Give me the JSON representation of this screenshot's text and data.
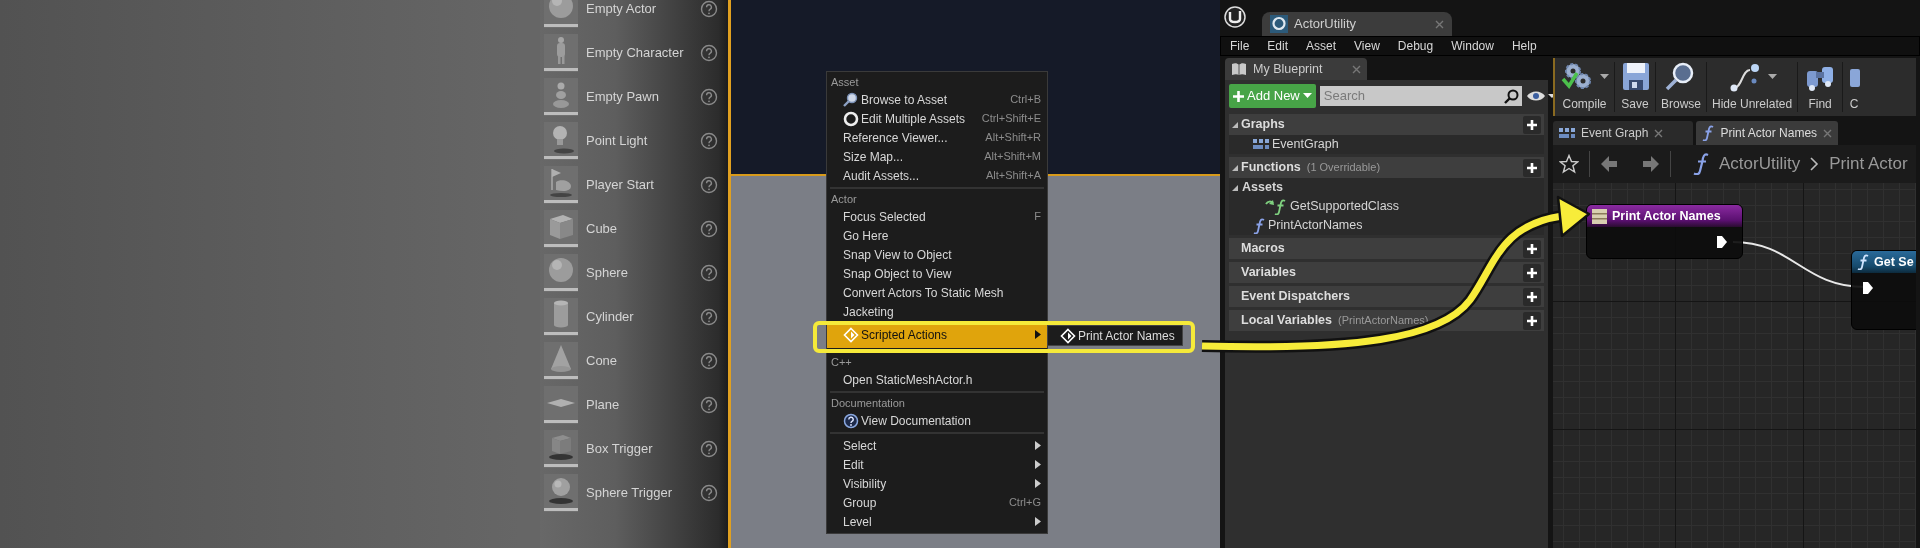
{
  "place_actors": {
    "items": [
      {
        "label": "Empty Actor",
        "kind": "sphere"
      },
      {
        "label": "Empty Character",
        "kind": "character"
      },
      {
        "label": "Empty Pawn",
        "kind": "pawn"
      },
      {
        "label": "Point Light",
        "kind": "light"
      },
      {
        "label": "Player Start",
        "kind": "flag"
      },
      {
        "label": "Cube",
        "kind": "cube"
      },
      {
        "label": "Sphere",
        "kind": "sphere"
      },
      {
        "label": "Cylinder",
        "kind": "cylinder"
      },
      {
        "label": "Cone",
        "kind": "cone"
      },
      {
        "label": "Plane",
        "kind": "plane"
      },
      {
        "label": "Box Trigger",
        "kind": "box-trigger"
      },
      {
        "label": "Sphere Trigger",
        "kind": "sphere-trigger"
      }
    ]
  },
  "context_menu": {
    "sections": [
      {
        "heading": "Asset",
        "items": [
          {
            "label": "Browse to Asset",
            "shortcut": "Ctrl+B",
            "kind": "browse",
            "has_submenu": false,
            "selected": false
          },
          {
            "label": "Edit Multiple Assets",
            "shortcut": "Ctrl+Shift+E",
            "kind": "multi-edit",
            "has_submenu": false,
            "selected": false
          },
          {
            "label": "Reference Viewer...",
            "shortcut": "Alt+Shift+R",
            "has_submenu": false,
            "selected": false
          },
          {
            "label": "Size Map...",
            "shortcut": "Alt+Shift+M",
            "has_submenu": false,
            "selected": false
          },
          {
            "label": "Audit Assets...",
            "shortcut": "Alt+Shift+A",
            "has_submenu": false,
            "selected": false
          }
        ]
      },
      {
        "heading": "Actor",
        "items": [
          {
            "label": "Focus Selected",
            "shortcut": "F",
            "has_submenu": false,
            "selected": false
          },
          {
            "label": "Go Here",
            "has_submenu": false,
            "selected": false
          },
          {
            "label": "Snap View to Object",
            "has_submenu": false,
            "selected": false
          },
          {
            "label": "Snap Object to View",
            "has_submenu": false,
            "selected": false
          },
          {
            "label": "Convert Actors To Static Mesh",
            "has_submenu": false,
            "selected": false
          },
          {
            "label": "Jacketing",
            "has_submenu": false,
            "selected": false
          },
          {
            "label": "Scripted Actions",
            "kind": "scripted",
            "has_submenu": true,
            "selected": true,
            "children": [
              {
                "label": "Print Actor Names",
                "kind": "scripted"
              }
            ]
          }
        ]
      },
      {
        "heading": "C++",
        "items": [
          {
            "label": "Open StaticMeshActor.h",
            "has_submenu": false,
            "selected": false
          }
        ]
      },
      {
        "heading": "Documentation",
        "items": [
          {
            "label": "View Documentation",
            "kind": "documentation",
            "has_submenu": false,
            "selected": false
          }
        ]
      },
      {
        "items": [
          {
            "label": "Select",
            "has_submenu": true,
            "selected": false
          },
          {
            "label": "Edit",
            "has_submenu": true,
            "selected": false
          },
          {
            "label": "Visibility",
            "has_submenu": true,
            "selected": false
          },
          {
            "label": "Group",
            "shortcut": "Ctrl+G",
            "has_submenu": false,
            "selected": false
          },
          {
            "label": "Level",
            "has_submenu": true,
            "selected": false
          }
        ]
      }
    ]
  },
  "editor": {
    "asset_tab": {
      "label": "ActorUtility"
    },
    "menu_bar": [
      "File",
      "Edit",
      "Asset",
      "View",
      "Debug",
      "Window",
      "Help"
    ],
    "my_blueprint": {
      "tab": "My Blueprint",
      "add_button": "Add New",
      "search": {
        "placeholder": "Search"
      },
      "sections": [
        {
          "title": "Graphs",
          "expanded": true,
          "items": [
            {
              "label": "EventGraph",
              "kind": "graph"
            }
          ]
        },
        {
          "title": "Functions",
          "note": "(1 Overridable)",
          "expanded": true,
          "items": [
            {
              "label": "Assets",
              "kind": "category",
              "expanded": true,
              "children": [
                {
                  "label": "GetSupportedClass",
                  "kind": "override"
                }
              ]
            },
            {
              "label": "PrintActorNames",
              "kind": "function"
            }
          ]
        },
        {
          "title": "Macros",
          "expanded": false
        },
        {
          "title": "Variables",
          "expanded": false
        },
        {
          "title": "Event Dispatchers",
          "expanded": false
        },
        {
          "title": "Local Variables",
          "note": "(PrintActorNames)",
          "expanded": false
        }
      ]
    },
    "toolbar": [
      {
        "label": "Compile",
        "kind": "compile",
        "dropdown": true
      },
      {
        "label": "Save",
        "kind": "save",
        "dropdown": false
      },
      {
        "label": "Browse",
        "kind": "browse",
        "dropdown": false
      },
      {
        "label": "Hide Unrelated",
        "kind": "hide-unrelated",
        "dropdown": true
      },
      {
        "label": "Find",
        "kind": "find",
        "dropdown": false
      },
      {
        "label": "C",
        "kind": "partial",
        "dropdown": false
      }
    ],
    "graph_tabs": [
      {
        "label": "Event Graph",
        "kind": "graph",
        "selected": false
      },
      {
        "label": "Print Actor Names",
        "kind": "function",
        "selected": true
      }
    ],
    "breadcrumb": [
      "ActorUtility",
      "Print Actor"
    ],
    "nodes": [
      {
        "title": "Print Actor Names",
        "kind": "entry"
      },
      {
        "title": "Get Se",
        "kind": "call"
      }
    ]
  }
}
